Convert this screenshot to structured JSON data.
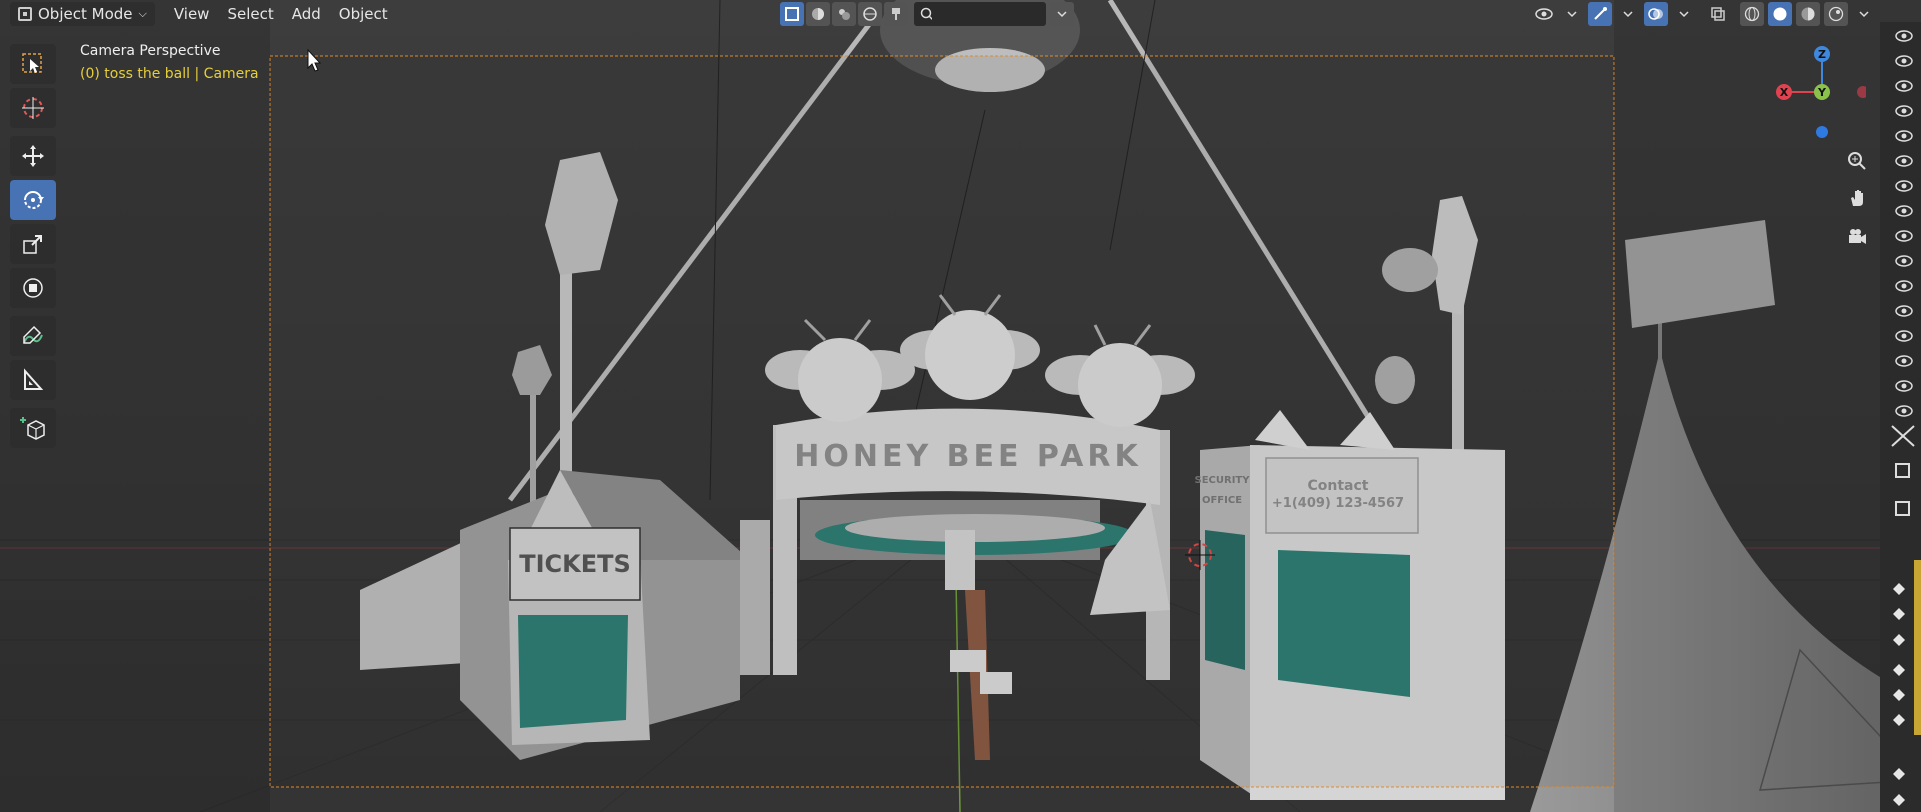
{
  "header": {
    "mode_label": "Object Mode",
    "menus": [
      "View",
      "Select",
      "Add",
      "Object"
    ],
    "search_placeholder": ""
  },
  "hud": {
    "view_name": "Camera Perspective",
    "object_info": "(0) toss the ball | Camera"
  },
  "toolbar": {
    "tools": [
      "select-box",
      "cursor",
      "move",
      "rotate",
      "scale",
      "transform",
      "annotate",
      "measure",
      "add-cube"
    ],
    "active_tool": "rotate"
  },
  "scene": {
    "sign_text": "HONEY BEE PARK",
    "tickets_text": "TICKETS",
    "contact_label": "Contact",
    "contact_phone": "+1(409) 123-4567",
    "office_line1": "SECURITY",
    "office_line2": "OFFICE"
  },
  "gizmo": {
    "x_label": "X",
    "y_label": "Y",
    "z_label": "Z",
    "x_color": "#e0434f",
    "y_color": "#8bc34a",
    "z_color": "#3f88e0"
  },
  "colors": {
    "accent": "#4772b3",
    "camera_frame": "#e08a2c",
    "hud_yellow": "#e6cf3a",
    "teal": "#2e7d73"
  }
}
